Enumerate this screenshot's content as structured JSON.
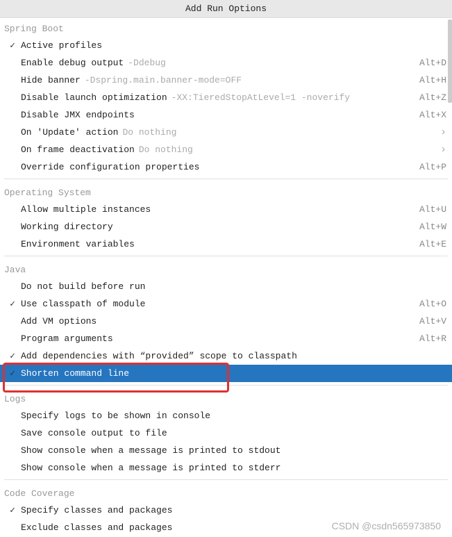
{
  "title": "Add Run Options",
  "watermark": "CSDN @csdn565973850",
  "sections": [
    {
      "name": "Spring Boot",
      "items": [
        {
          "id": "active-profiles",
          "label": "Active profiles",
          "checked": true
        },
        {
          "id": "enable-debug-output",
          "label": "Enable debug output",
          "hint": "-Ddebug",
          "shortcut": "Alt+D"
        },
        {
          "id": "hide-banner",
          "label": "Hide banner",
          "hint": "-Dspring.main.banner-mode=OFF",
          "shortcut": "Alt+H"
        },
        {
          "id": "disable-launch-optimization",
          "label": "Disable launch optimization",
          "hint": "-XX:TieredStopAtLevel=1 -noverify",
          "shortcut": "Alt+Z"
        },
        {
          "id": "disable-jmx-endpoints",
          "label": "Disable JMX endpoints",
          "shortcut": "Alt+X"
        },
        {
          "id": "on-update-action",
          "label": "On 'Update' action",
          "hint": "Do nothing",
          "submenu": true
        },
        {
          "id": "on-frame-deactivation",
          "label": "On frame deactivation",
          "hint": "Do nothing",
          "submenu": true
        },
        {
          "id": "override-config-properties",
          "label": "Override configuration properties",
          "shortcut": "Alt+P"
        }
      ]
    },
    {
      "name": "Operating System",
      "items": [
        {
          "id": "allow-multiple-instances",
          "label": "Allow multiple instances",
          "shortcut": "Alt+U"
        },
        {
          "id": "working-directory",
          "label": "Working directory",
          "shortcut": "Alt+W"
        },
        {
          "id": "environment-variables",
          "label": "Environment variables",
          "shortcut": "Alt+E"
        }
      ]
    },
    {
      "name": "Java",
      "items": [
        {
          "id": "do-not-build-before-run",
          "label": "Do not build before run"
        },
        {
          "id": "use-classpath-of-module",
          "label": "Use classpath of module",
          "checked": true,
          "shortcut": "Alt+O"
        },
        {
          "id": "add-vm-options",
          "label": "Add VM options",
          "shortcut": "Alt+V"
        },
        {
          "id": "program-arguments",
          "label": "Program arguments",
          "shortcut": "Alt+R"
        },
        {
          "id": "add-dependencies-provided",
          "label": "Add dependencies with “provided” scope to classpath",
          "checked": true
        },
        {
          "id": "shorten-command-line",
          "label": "Shorten command line",
          "checked": true,
          "selected": true,
          "highlighted": true
        }
      ]
    },
    {
      "name": "Logs",
      "items": [
        {
          "id": "specify-logs",
          "label": "Specify logs to be shown in console"
        },
        {
          "id": "save-console-output",
          "label": "Save console output to file"
        },
        {
          "id": "console-msg-stdout",
          "label": "Show console when a message is printed to stdout"
        },
        {
          "id": "console-msg-stderr",
          "label": "Show console when a message is printed to stderr"
        }
      ]
    },
    {
      "name": "Code Coverage",
      "items": [
        {
          "id": "specify-classes-packages",
          "label": "Specify classes and packages",
          "checked": true
        },
        {
          "id": "exclude-classes-packages",
          "label": "Exclude classes and packages"
        }
      ]
    }
  ]
}
